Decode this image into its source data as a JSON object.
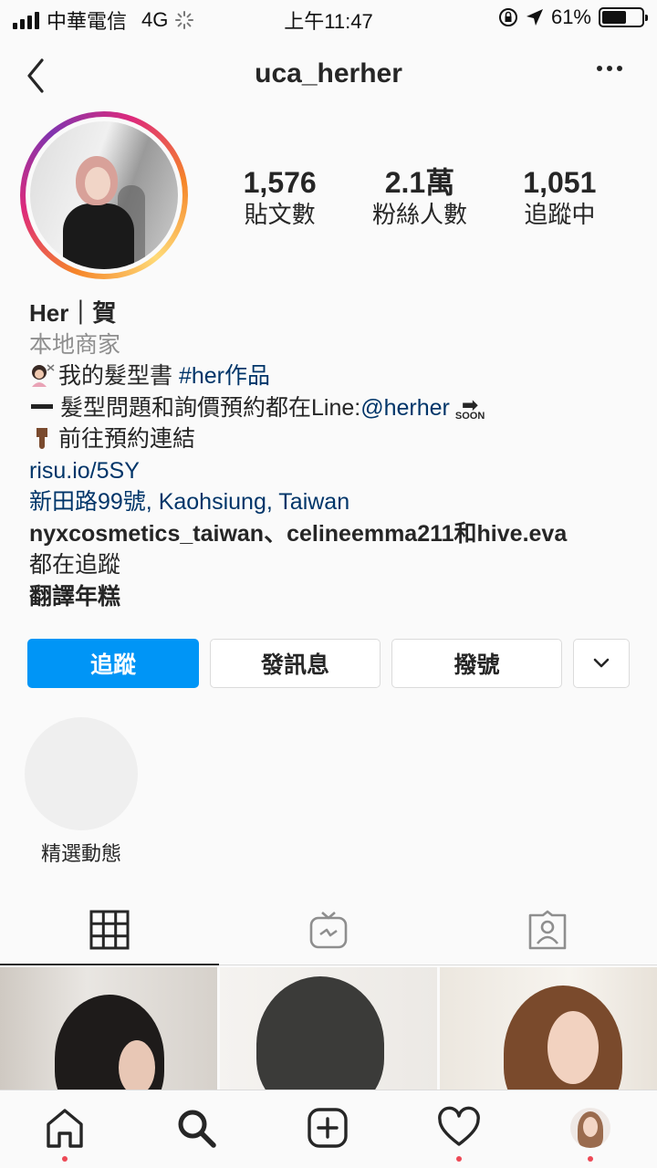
{
  "status_bar": {
    "carrier": "中華電信",
    "network": "4G",
    "time": "上午11:47",
    "battery": "61%",
    "battery_level": 0.61
  },
  "header": {
    "username": "uca_herher"
  },
  "profile": {
    "stats": [
      {
        "value": "1,576",
        "label": "貼文數"
      },
      {
        "value": "2.1萬",
        "label": "粉絲人數"
      },
      {
        "value": "1,051",
        "label": "追蹤中"
      }
    ],
    "display_name": "Her｜賀",
    "category": "本地商家",
    "bio_line1_text": "我的髮型書 ",
    "bio_line1_hashtag": "#her作品",
    "bio_line2_text": "髮型問題和詢價預約都在Line:",
    "bio_line2_handle": "@herher",
    "bio_line2_soon": "SOON",
    "bio_line3_text": "前往預約連結",
    "website": "risu.io/5SY",
    "address": "新田路99號, Kaohsiung, Taiwan",
    "followed_by_line1": "nyxcosmetics_taiwan、celineemma211和hive.eva",
    "followed_by_line2": "都在追蹤",
    "translate": "翻譯年糕"
  },
  "buttons": {
    "follow": "追蹤",
    "message": "發訊息",
    "call": "撥號"
  },
  "highlights": [
    {
      "label": "精選動態"
    }
  ],
  "tabs": [
    {
      "icon": "grid-icon",
      "active": true
    },
    {
      "icon": "igtv-icon",
      "active": false
    },
    {
      "icon": "tagged-icon",
      "active": false
    }
  ],
  "bottom_nav": [
    {
      "icon": "home-icon",
      "dot": true
    },
    {
      "icon": "search-icon",
      "dot": false
    },
    {
      "icon": "add-post-icon",
      "dot": false
    },
    {
      "icon": "activity-heart-icon",
      "dot": true
    },
    {
      "icon": "profile-avatar-icon",
      "dot": true
    }
  ],
  "colors": {
    "accent": "#0095f6",
    "link": "#003569",
    "notification_dot": "#ed4956"
  }
}
